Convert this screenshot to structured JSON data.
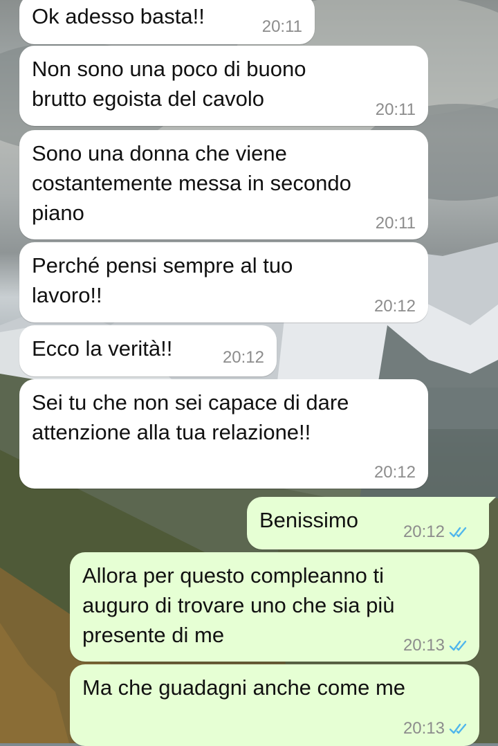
{
  "messages": [
    {
      "direction": "in",
      "text": "Ok adesso basta!!",
      "time": "20:11"
    },
    {
      "direction": "in",
      "text": "Non sono una poco di buono\nbrutto egoista del cavolo",
      "time": "20:11"
    },
    {
      "direction": "in",
      "text": "Sono una donna che viene\ncostantemente messa in secondo\npiano",
      "time": "20:11"
    },
    {
      "direction": "in",
      "text": "Perché pensi sempre al tuo\nlavoro!!",
      "time": "20:12"
    },
    {
      "direction": "in",
      "text": "Ecco la verità!!",
      "time": "20:12"
    },
    {
      "direction": "in",
      "text": "Sei tu che non sei capace di dare\nattenzione alla tua relazione!!",
      "time": "20:12"
    },
    {
      "direction": "out",
      "text": "Benissimo",
      "time": "20:12",
      "status": "read"
    },
    {
      "direction": "out",
      "text": "Allora per questo compleanno ti\nauguro di trovare uno che sia più\npresente di me",
      "time": "20:13",
      "status": "read"
    },
    {
      "direction": "out",
      "text": "Ma che guadagni anche come me",
      "time": "20:13",
      "status": "read"
    }
  ],
  "colors": {
    "incoming_bubble": "#ffffff",
    "outgoing_bubble": "#e6ffd4",
    "timestamp": "#8c8c8c",
    "read_ticks": "#4fb6ec"
  },
  "icons": {
    "read_receipt": "double-check-icon"
  },
  "wallpaper": "mountain-landscape"
}
